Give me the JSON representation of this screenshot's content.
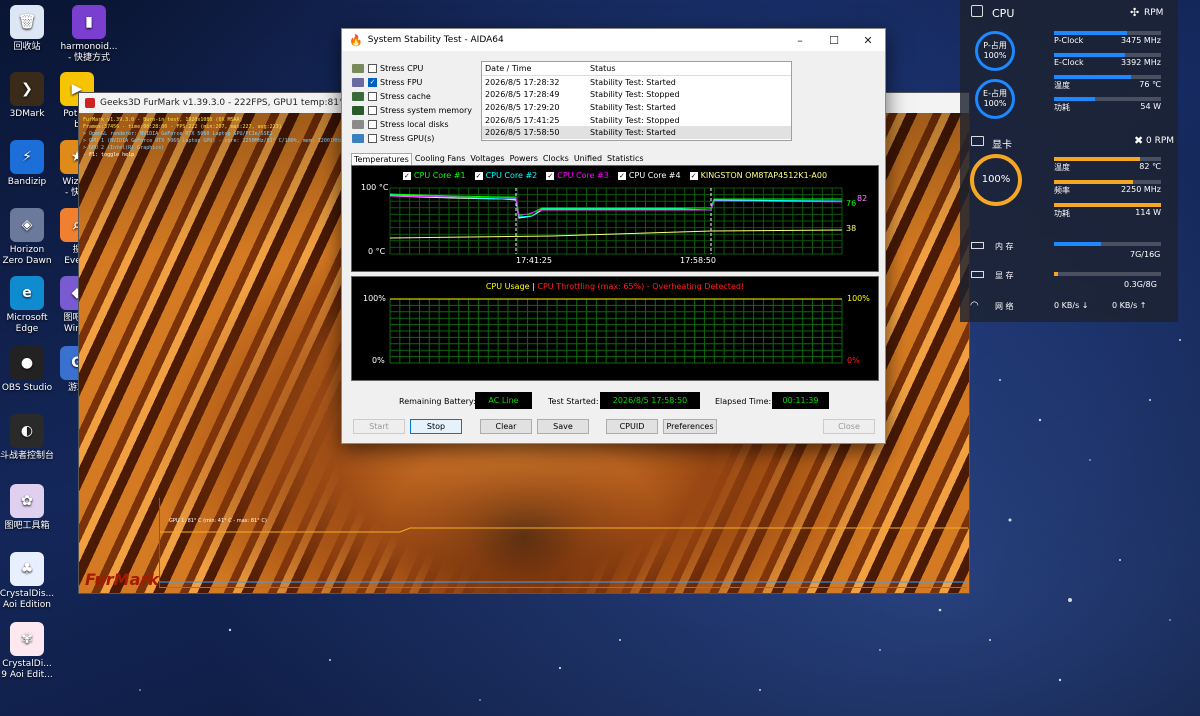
{
  "desktop": {
    "icons": [
      {
        "label": "回收站",
        "color": "#dde6f4",
        "glyph": "🗑"
      },
      {
        "label": "harmonoid...\n- 快捷方式",
        "color": "#7b3fd0",
        "glyph": "▮"
      },
      {
        "label": "3DMark",
        "color": "#3a2a1a",
        "glyph": "❯"
      },
      {
        "label": "PotPla\nb",
        "color": "#f6c400",
        "glyph": "▶"
      },
      {
        "label": "Bandizip",
        "color": "#1c6fd9",
        "glyph": "⚡"
      },
      {
        "label": "WizTre\n- 快捷",
        "color": "#e08a1a",
        "glyph": "★"
      },
      {
        "label": "Horizon\nZero Dawn",
        "color": "#6b7a9a",
        "glyph": "◈"
      },
      {
        "label": "搜\nEvery",
        "color": "#f08030",
        "glyph": "⌕"
      },
      {
        "label": "Microsoft\nEdge",
        "color": "#0f8bd0",
        "glyph": "e"
      },
      {
        "label": "图吧工\nWinUI",
        "color": "#7a5ad0",
        "glyph": "◆"
      },
      {
        "label": "OBS Studio",
        "color": "#222222",
        "glyph": "●"
      },
      {
        "label": "游戏",
        "color": "#3a70d0",
        "glyph": "G"
      },
      {
        "label": "斗战者控制台",
        "color": "#2a2a2a",
        "glyph": "◐"
      },
      {
        "label": "图吧工具箱",
        "color": "#e0d0f0",
        "glyph": "✿"
      },
      {
        "label": "CrystalDis...\nAoi Edition",
        "color": "#e8f0ff",
        "glyph": "♣"
      },
      {
        "label": "CrystalDi...\n9 Aoi Edit...",
        "color": "#fde8f0",
        "glyph": "✾"
      }
    ]
  },
  "furmark": {
    "title": "Geeks3D FurMark v1.39.3.0 - 222FPS, GPU1 temp:81°C, GPU1 usa",
    "osd": [
      "FurMark v1.39.3.0 - Burn-in test, 1920x1080 (0X MSAA)",
      "Frames:37456 - time:00:28:00 - FPS:222 (min:207, max:227, avg:223)",
      "> OpenGL renderer: NVIDIA GeForce RTX 5060 Laptop GPU/PCIe/SSE2",
      "> GPU 1 (NVIDIA GeForce RTX 5060 Laptop GPU) - core: 2250MHz/81° C/100%, mem: 12001MHz/4%, limits",
      "> GPU 2 (Intel(R) Graphics)",
      "- F1: toggle help"
    ],
    "graph_label": "GPU 1: 81° C (min: 41° C - max: 81° C)",
    "logo": "FurMark"
  },
  "aida": {
    "title": "System Stability Test - AIDA64",
    "stress": [
      {
        "label": "Stress CPU",
        "checked": false,
        "color": "#7a8a5a"
      },
      {
        "label": "Stress FPU",
        "checked": true,
        "color": "#6a6aa0"
      },
      {
        "label": "Stress cache",
        "checked": false,
        "color": "#3a6a3a"
      },
      {
        "label": "Stress system memory",
        "checked": false,
        "color": "#2a5a2a"
      },
      {
        "label": "Stress local disks",
        "checked": false,
        "color": "#8a8a8a"
      },
      {
        "label": "Stress GPU(s)",
        "checked": false,
        "color": "#3a80c0"
      }
    ],
    "log_headers": [
      "Date / Time",
      "Status"
    ],
    "log": [
      [
        "2026/8/5 17:28:32",
        "Stability Test: Started"
      ],
      [
        "2026/8/5 17:28:49",
        "Stability Test: Stopped"
      ],
      [
        "2026/8/5 17:29:20",
        "Stability Test: Started"
      ],
      [
        "2026/8/5 17:41:25",
        "Stability Test: Stopped"
      ],
      [
        "2026/8/5 17:58:50",
        "Stability Test: Started"
      ]
    ],
    "tabs": [
      "Temperatures",
      "Cooling Fans",
      "Voltages",
      "Powers",
      "Clocks",
      "Unified",
      "Statistics"
    ],
    "temp_graph": {
      "legend": [
        {
          "label": "CPU Core #1",
          "color": "#00ff00"
        },
        {
          "label": "CPU Core #2",
          "color": "#00ffff"
        },
        {
          "label": "CPU Core #3",
          "color": "#ff00ff"
        },
        {
          "label": "CPU Core #4",
          "color": "#ffffff"
        },
        {
          "label": "KINGSTON OM8TAP4512K1-A00",
          "color": "#ffff80"
        }
      ],
      "y_top": "100 °C",
      "y_bottom": "0 °C",
      "x_labels": [
        "17:41:25",
        "17:58:50"
      ],
      "right_values": [
        "82",
        "76",
        "38"
      ]
    },
    "usage_graph": {
      "title_a": "CPU Usage",
      "sep": "|",
      "title_b": "CPU Throttling (max: 65%) - Overheating Detected!",
      "y_top": "100%",
      "y_bottom": "0%",
      "right_top": "100%",
      "right_bottom": "0%"
    },
    "status": {
      "battery_label": "Remaining Battery:",
      "battery_value": "AC Line",
      "started_label": "Test Started:",
      "started_value": "2026/8/5 17:58:50",
      "elapsed_label": "Elapsed Time:",
      "elapsed_value": "00:11:39"
    },
    "buttons": {
      "start": "Start",
      "stop": "Stop",
      "clear": "Clear",
      "save": "Save",
      "cpuid": "CPUID",
      "preferences": "Preferences",
      "close": "Close"
    }
  },
  "monitor": {
    "cpu_title": "CPU",
    "cpu_fan": "RPM",
    "p_ring": {
      "label": "P-占用",
      "value": "100%"
    },
    "e_ring": {
      "label": "E-占用",
      "value": "100%"
    },
    "cpu_rows": [
      {
        "label": "P-Clock",
        "value": "3475 MHz",
        "fill": 0.68
      },
      {
        "label": "E-Clock",
        "value": "3392 MHz",
        "fill": 0.66
      },
      {
        "label": "温度",
        "value": "76 ℃",
        "fill": 0.72
      },
      {
        "label": "功耗",
        "value": "54 W",
        "fill": 0.38
      }
    ],
    "gpu_title": "显卡",
    "gpu_fan": "0 RPM",
    "gpu_ring": {
      "value": "100%"
    },
    "gpu_rows": [
      {
        "label": "温度",
        "value": "82 ℃",
        "fill": 0.8
      },
      {
        "label": "频率",
        "value": "2250 MHz",
        "fill": 0.74
      },
      {
        "label": "功耗",
        "value": "114 W",
        "fill": 1.0
      }
    ],
    "mem": {
      "label": "内  存",
      "value": "7G/16G",
      "fill": 0.44
    },
    "vram": {
      "label": "显  存",
      "value": "0.3G/8G",
      "fill": 0.04
    },
    "net": {
      "label": "网  络",
      "down": "0 KB/s ↓",
      "up": "0 KB/s ↑"
    },
    "colors": {
      "cpu": "#1e88ff",
      "gpu": "#f5a623"
    }
  }
}
